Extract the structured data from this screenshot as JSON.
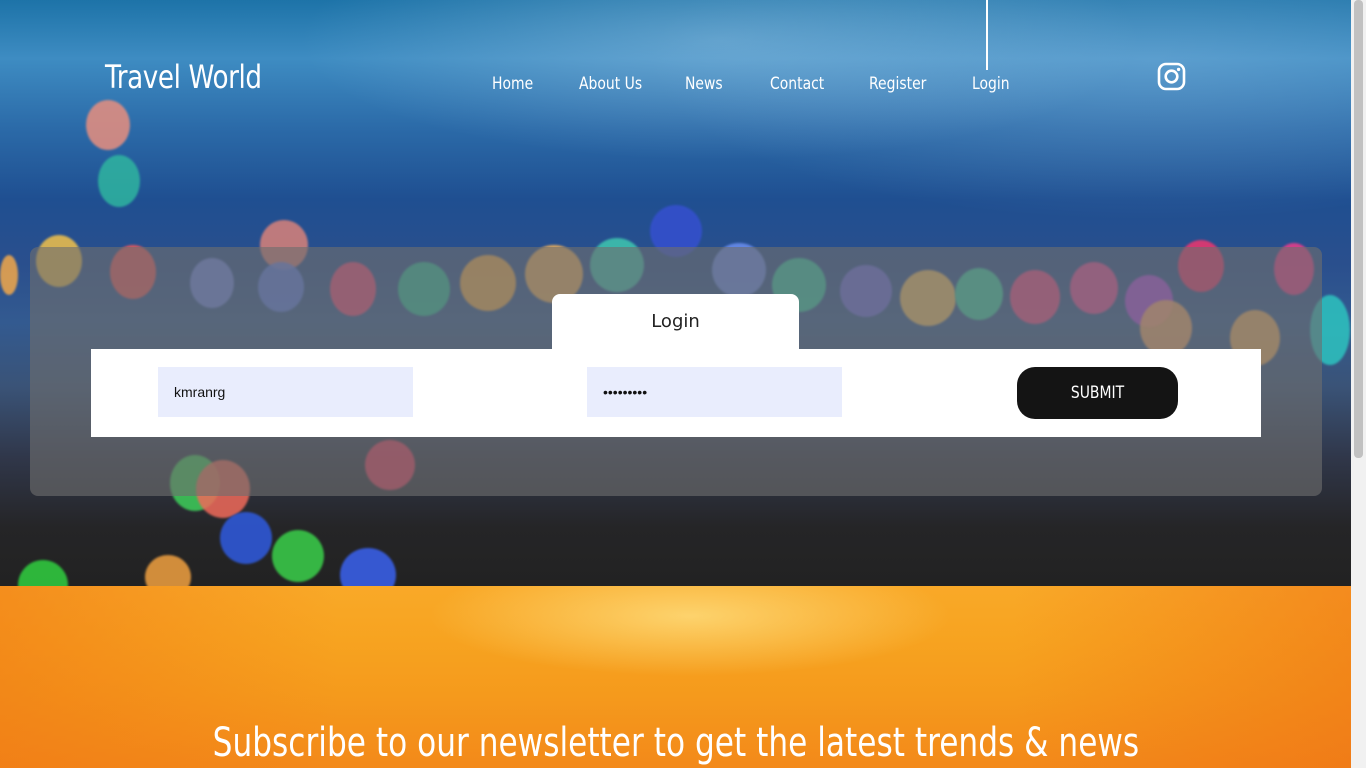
{
  "header": {
    "brand": "Travel World",
    "nav": [
      {
        "label": "Home"
      },
      {
        "label": "About Us"
      },
      {
        "label": "News"
      },
      {
        "label": "Contact"
      },
      {
        "label": "Register"
      },
      {
        "label": "Login"
      }
    ],
    "social_icon": "instagram-icon"
  },
  "login": {
    "tab_label": "Login",
    "username_value": "kmranrg",
    "password_value": "•••••••••",
    "submit_label": "SUBMIT"
  },
  "newsletter": {
    "title": "Subscribe to our newsletter to get the latest trends & news"
  },
  "colors": {
    "panel": "#6e6e6e",
    "input_bg": "#e9edfd",
    "button_bg": "#141414",
    "newsletter_bg": "#f7a320"
  }
}
